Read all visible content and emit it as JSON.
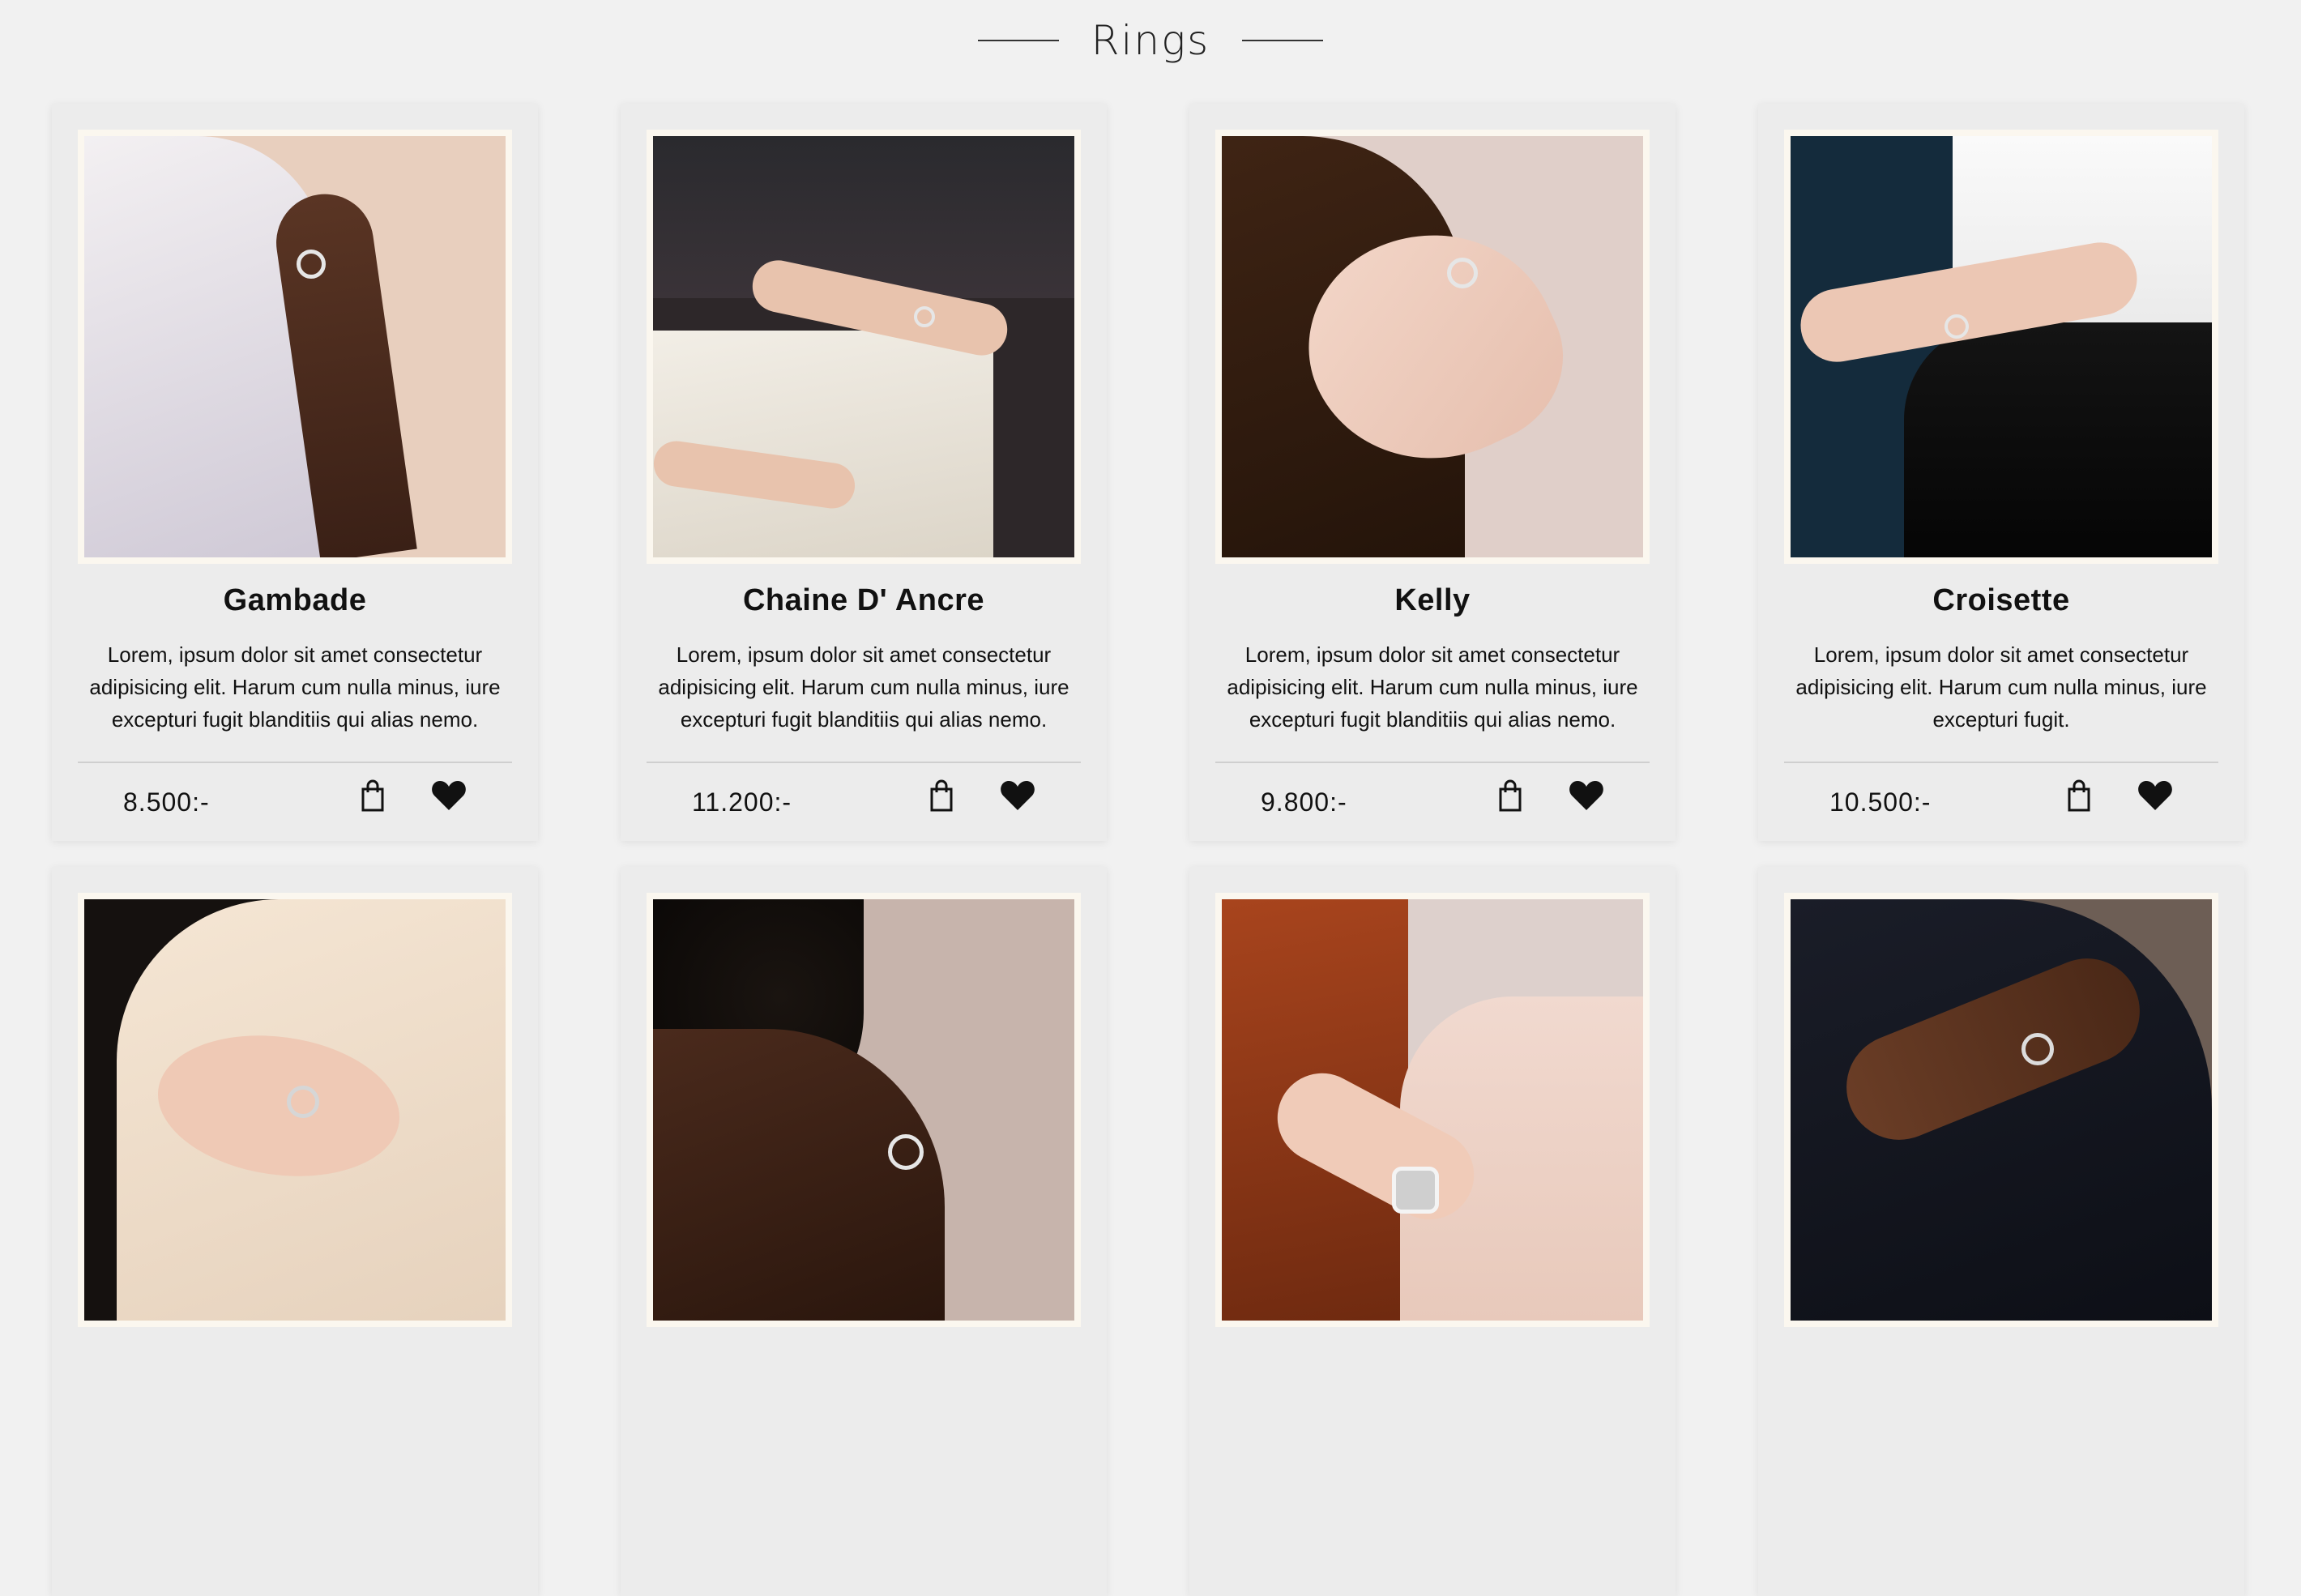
{
  "section": {
    "title": "Rings"
  },
  "products": [
    {
      "name": "Gambade",
      "description": "Lorem, ipsum dolor sit amet consectetur adipisicing elit. Harum cum nulla minus, iure excepturi fugit blanditiis qui alias nemo.",
      "price": "8.500:-"
    },
    {
      "name": "Chaine D' Ancre",
      "description": "Lorem, ipsum dolor sit amet consectetur adipisicing elit. Harum cum nulla minus, iure excepturi fugit blanditiis qui alias nemo.",
      "price": "11.200:-"
    },
    {
      "name": "Kelly",
      "description": "Lorem, ipsum dolor sit amet consectetur adipisicing elit. Harum cum nulla minus, iure excepturi fugit blanditiis qui alias nemo.",
      "price": "9.800:-"
    },
    {
      "name": "Croisette",
      "description": "Lorem, ipsum dolor sit amet consectetur adipisicing elit. Harum cum nulla minus, iure excepturi fugit.",
      "price": "10.500:-"
    }
  ],
  "icons": {
    "cart": "shopping-bag-icon",
    "favorite": "heart-icon"
  },
  "colors": {
    "background": "#f1f1f1",
    "card": "#ececec",
    "frame": "#fbf7ef",
    "text": "#111111"
  }
}
